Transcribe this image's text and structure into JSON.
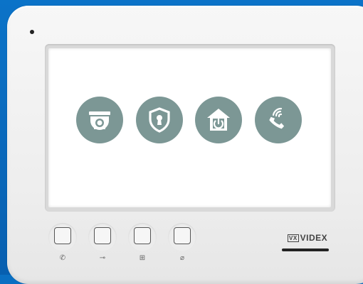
{
  "device": {
    "brand": "VIDEX",
    "brand_mark": "VX"
  },
  "screen_icons": [
    {
      "name": "camera-dome-icon"
    },
    {
      "name": "shield-keyhole-icon"
    },
    {
      "name": "home-power-icon"
    },
    {
      "name": "phone-signal-icon"
    }
  ],
  "buttons": [
    {
      "name": "call-button",
      "symbol": "✆"
    },
    {
      "name": "door-release-button",
      "symbol": "⊸"
    },
    {
      "name": "menu-button",
      "symbol": "⊞"
    },
    {
      "name": "mute-button",
      "symbol": "⌀"
    }
  ],
  "colors": {
    "background": "#0a6fc2",
    "icon_fill": "#7c9795",
    "device_body": "#f0f0f0"
  }
}
